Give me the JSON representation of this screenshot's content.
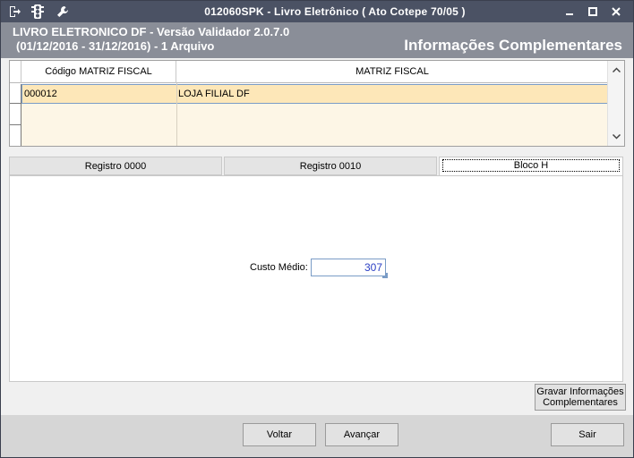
{
  "window": {
    "title": "012060SPK - Livro Eletrônico ( Ato Cotepe 70/05 )",
    "icons": [
      "exit-icon",
      "traffic-light-icon",
      "wrench-icon"
    ],
    "controls": {
      "minimize": "▬",
      "maximize": "◻",
      "close": "✕"
    }
  },
  "header": {
    "line1": "LIVRO ELETRONICO DF - Versão Validador 2.0.7.0",
    "line2": "(01/12/2016 - 31/12/2016) - 1 Arquivo",
    "section": "Informações Complementares"
  },
  "grid": {
    "columns": [
      "Código MATRIZ FISCAL",
      "MATRIZ FISCAL"
    ],
    "rows": [
      {
        "codigo": "000012",
        "matriz": "LOJA FILIAL DF"
      }
    ]
  },
  "tabs": [
    {
      "label": "Registro 0000",
      "active": false
    },
    {
      "label": "Registro 0010",
      "active": false
    },
    {
      "label": "Bloco H",
      "active": true
    }
  ],
  "form": {
    "custo_medio_label": "Custo Médio:",
    "custo_medio_value": "307"
  },
  "buttons": {
    "gravar_line1": "Gravar Informações",
    "gravar_line2": "Complementares",
    "voltar": "Voltar",
    "avancar": "Avançar",
    "sair": "Sair"
  },
  "colors": {
    "titlebar": "#4b5264",
    "header": "#8a8e98",
    "selected_row": "#fde7b8",
    "input_text": "#2b3fc4"
  }
}
